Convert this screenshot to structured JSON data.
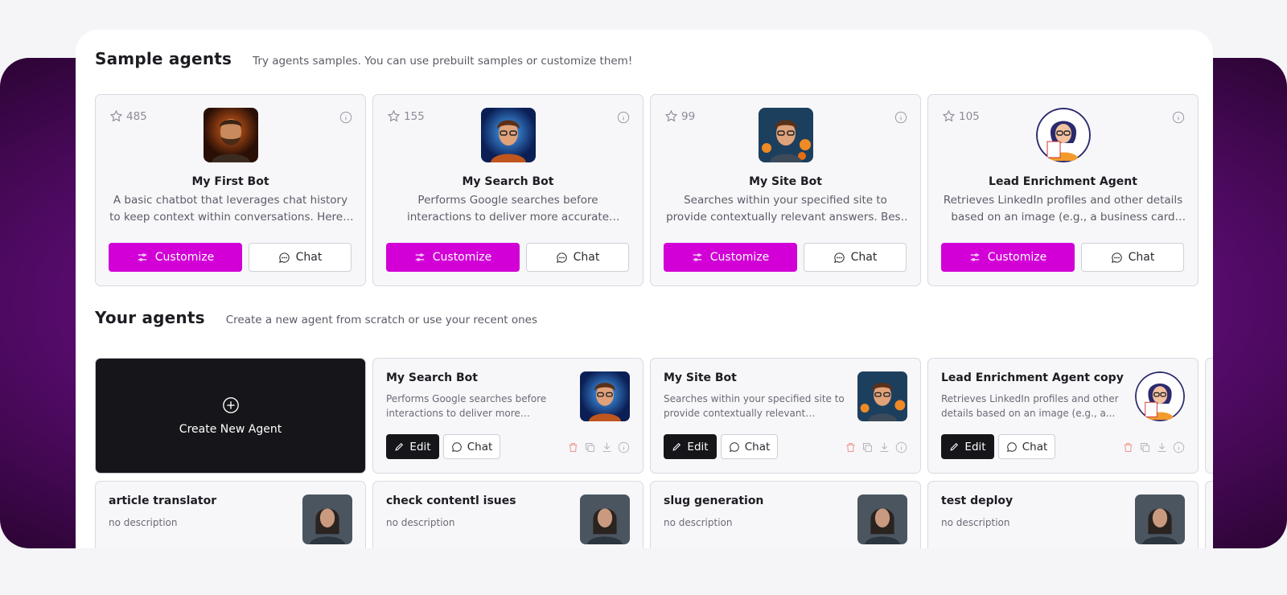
{
  "sample_section": {
    "title": "Sample agents",
    "subtitle": "Try agents samples. You can use prebuilt samples or customize them!"
  },
  "sample_agents": [
    {
      "stars": "485",
      "name": "My First Bot",
      "description": "A basic chatbot that leverages chat history to keep context within conversations. Here's a...",
      "customize_label": "Customize",
      "chat_label": "Chat",
      "avatar": "bearded-man-avatar"
    },
    {
      "stars": "155",
      "name": "My Search Bot",
      "description": "Performs Google searches before interactions to deliver more accurate answers. Perfect fo...",
      "customize_label": "Customize",
      "chat_label": "Chat",
      "avatar": "glasses-man-blue-avatar"
    },
    {
      "stars": "99",
      "name": "My Site Bot",
      "description": "Searches within your specified site to provide contextually relevant answers. Best for...",
      "customize_label": "Customize",
      "chat_label": "Chat",
      "avatar": "glasses-man-flowers-avatar"
    },
    {
      "stars": "105",
      "name": "Lead Enrichment Agent",
      "description": "Retrieves LinkedIn profiles and other details based on an image (e.g., a business card or...",
      "customize_label": "Customize",
      "chat_label": "Chat",
      "avatar": "woman-with-card-avatar"
    }
  ],
  "your_section": {
    "title": "Your agents",
    "subtitle": "Create a new agent from scratch or use your recent ones"
  },
  "create_new": {
    "label": "Create New Agent"
  },
  "your_agents": [
    {
      "name": "My Search Bot",
      "description": "Performs Google searches before interactions to deliver more accurate...",
      "edit_label": "Edit",
      "chat_label": "Chat",
      "avatar": "glasses-man-blue-avatar"
    },
    {
      "name": "My Site Bot",
      "description": "Searches within your specified site to provide contextually relevant answers...",
      "edit_label": "Edit",
      "chat_label": "Chat",
      "avatar": "glasses-man-flowers-avatar"
    },
    {
      "name": "Lead Enrichment Agent copy",
      "description": "Retrieves LinkedIn profiles and other details based on an image (e.g., a...",
      "edit_label": "Edit",
      "chat_label": "Chat",
      "avatar": "woman-with-card-avatar"
    }
  ],
  "more_agents": [
    {
      "name": "article translator",
      "description": "no description",
      "avatar": "warrior-woman-avatar"
    },
    {
      "name": "check contentl isues",
      "description": "no description",
      "avatar": "warrior-woman-avatar"
    },
    {
      "name": "slug generation",
      "description": "no description",
      "avatar": "warrior-woman-avatar"
    },
    {
      "name": "test deploy",
      "description": "no description",
      "avatar": "warrior-woman-avatar"
    }
  ],
  "colors": {
    "accent": "#d200d7",
    "dark": "#16161a",
    "backdrop": "#7a1294"
  }
}
